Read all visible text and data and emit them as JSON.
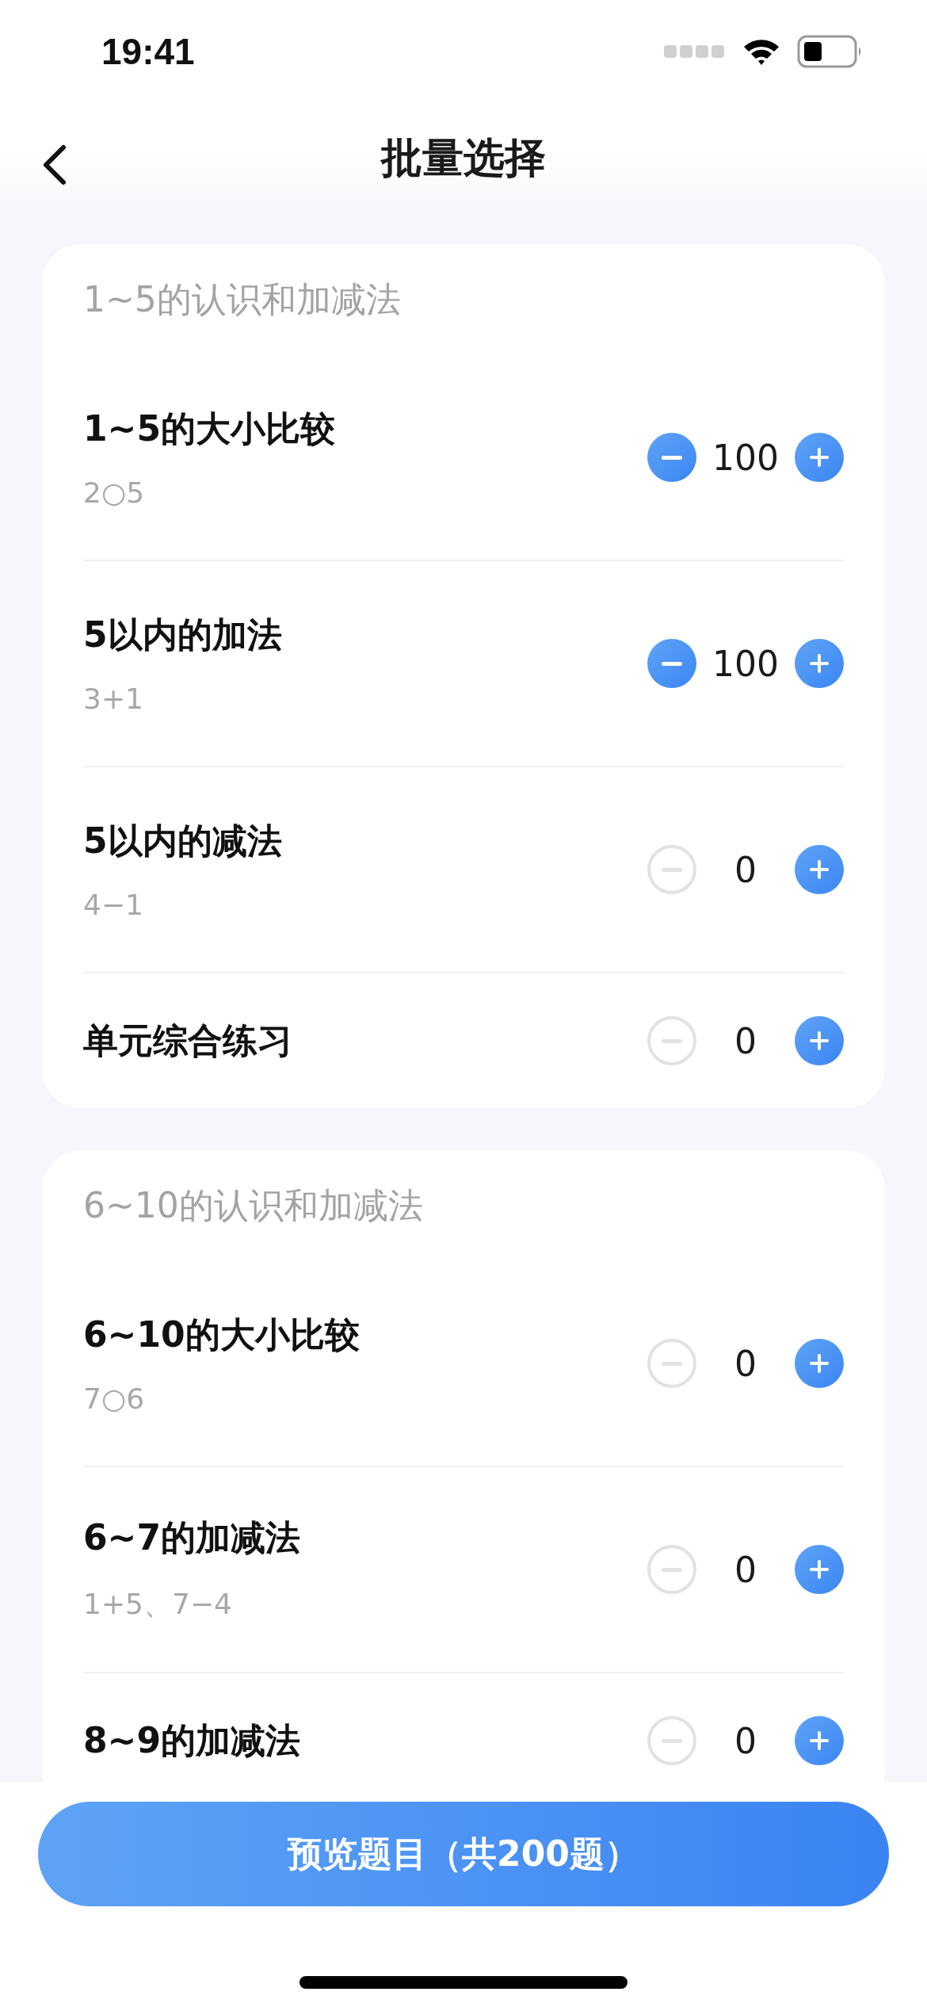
{
  "status_bar": {
    "time": "19:41"
  },
  "nav": {
    "title": "批量选择"
  },
  "sections": [
    {
      "title": "1~5的认识和加减法",
      "items": [
        {
          "title": "1~5的大小比较",
          "example": "2○5",
          "count": "100",
          "minus_disabled": false
        },
        {
          "title": "5以内的加法",
          "example": "3+1",
          "count": "100",
          "minus_disabled": false
        },
        {
          "title": "5以内的减法",
          "example": "4−1",
          "count": "0",
          "minus_disabled": true
        },
        {
          "title": "单元综合练习",
          "count": "0",
          "minus_disabled": true
        }
      ]
    },
    {
      "title": "6~10的认识和加减法",
      "items": [
        {
          "title": "6~10的大小比较",
          "example": "7○6",
          "count": "0",
          "minus_disabled": true
        },
        {
          "title": "6~7的加减法",
          "example": "1+5、7−4",
          "count": "0",
          "minus_disabled": true
        },
        {
          "title": "8~9的加减法",
          "count": "0",
          "minus_disabled": true
        }
      ]
    }
  ],
  "footer": {
    "button": "预览题目（共200题）"
  }
}
